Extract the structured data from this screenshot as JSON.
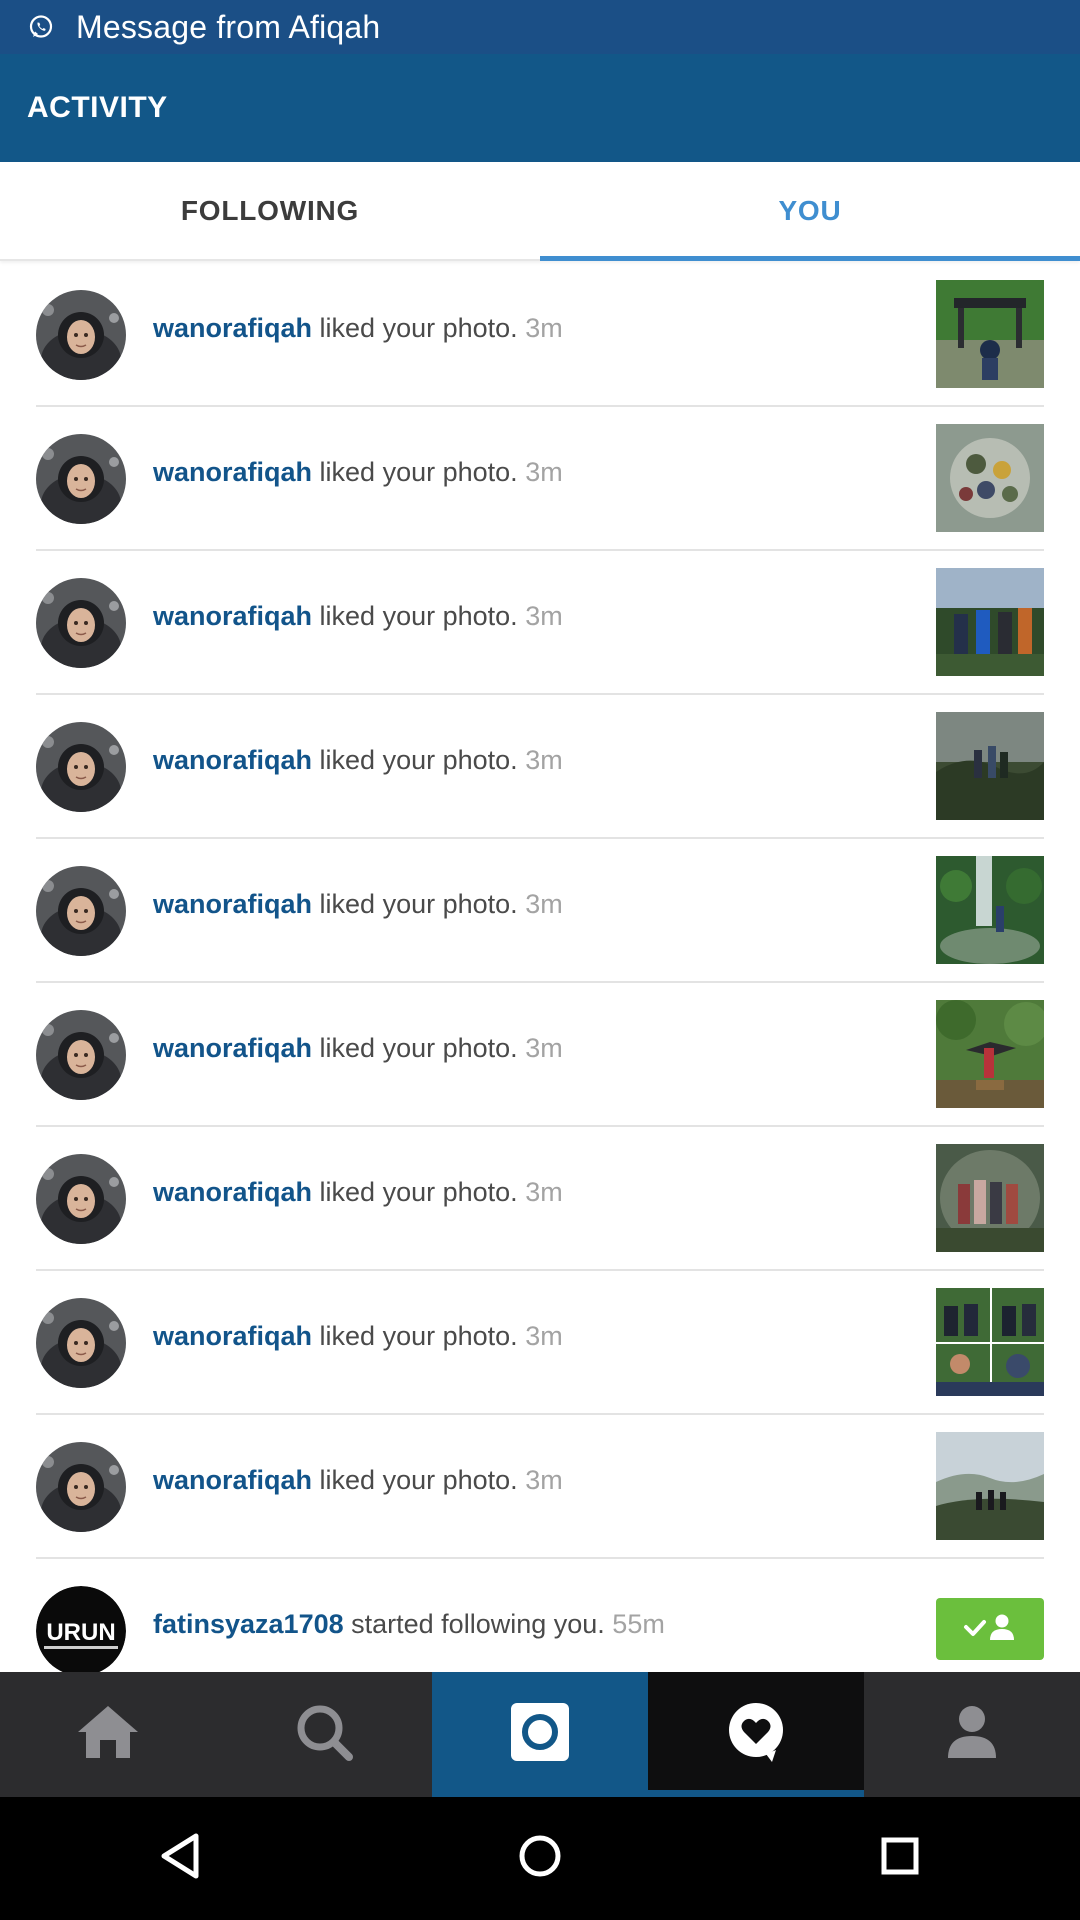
{
  "notification": {
    "text": "Message from Afiqah",
    "icon": "whatsapp-icon"
  },
  "action_bar": {
    "title": "ACTIVITY"
  },
  "tabs": [
    {
      "label": "FOLLOWING",
      "selected": false
    },
    {
      "label": "YOU",
      "selected": true
    }
  ],
  "colors": {
    "notification_bar": "#1b4f86",
    "action_bar": "#125788",
    "accent": "#3f8ed0",
    "username": "#12548a",
    "follow_button": "#6bbf3d"
  },
  "activity": [
    {
      "username": "wanorafiqah",
      "action": "liked your photo.",
      "time": "3m"
    },
    {
      "username": "wanorafiqah",
      "action": "liked your photo.",
      "time": "3m"
    },
    {
      "username": "wanorafiqah",
      "action": "liked your photo.",
      "time": "3m"
    },
    {
      "username": "wanorafiqah",
      "action": "liked your photo.",
      "time": "3m"
    },
    {
      "username": "wanorafiqah",
      "action": "liked your photo.",
      "time": "3m"
    },
    {
      "username": "wanorafiqah",
      "action": "liked your photo.",
      "time": "3m"
    },
    {
      "username": "wanorafiqah",
      "action": "liked your photo.",
      "time": "3m"
    },
    {
      "username": "wanorafiqah",
      "action": "liked your photo.",
      "time": "3m"
    },
    {
      "username": "wanorafiqah",
      "action": "liked your photo.",
      "time": "3m"
    },
    {
      "username": "fatinsyaza1708",
      "action": "started following you.",
      "time": "55m"
    }
  ],
  "bottom_tabs": [
    {
      "icon": "home-icon"
    },
    {
      "icon": "search-icon"
    },
    {
      "icon": "camera-icon"
    },
    {
      "icon": "activity-heart-icon",
      "selected": true
    },
    {
      "icon": "profile-icon"
    }
  ],
  "nav_buttons": [
    {
      "icon": "back-icon"
    },
    {
      "icon": "home-circle-icon"
    },
    {
      "icon": "recents-icon"
    }
  ]
}
